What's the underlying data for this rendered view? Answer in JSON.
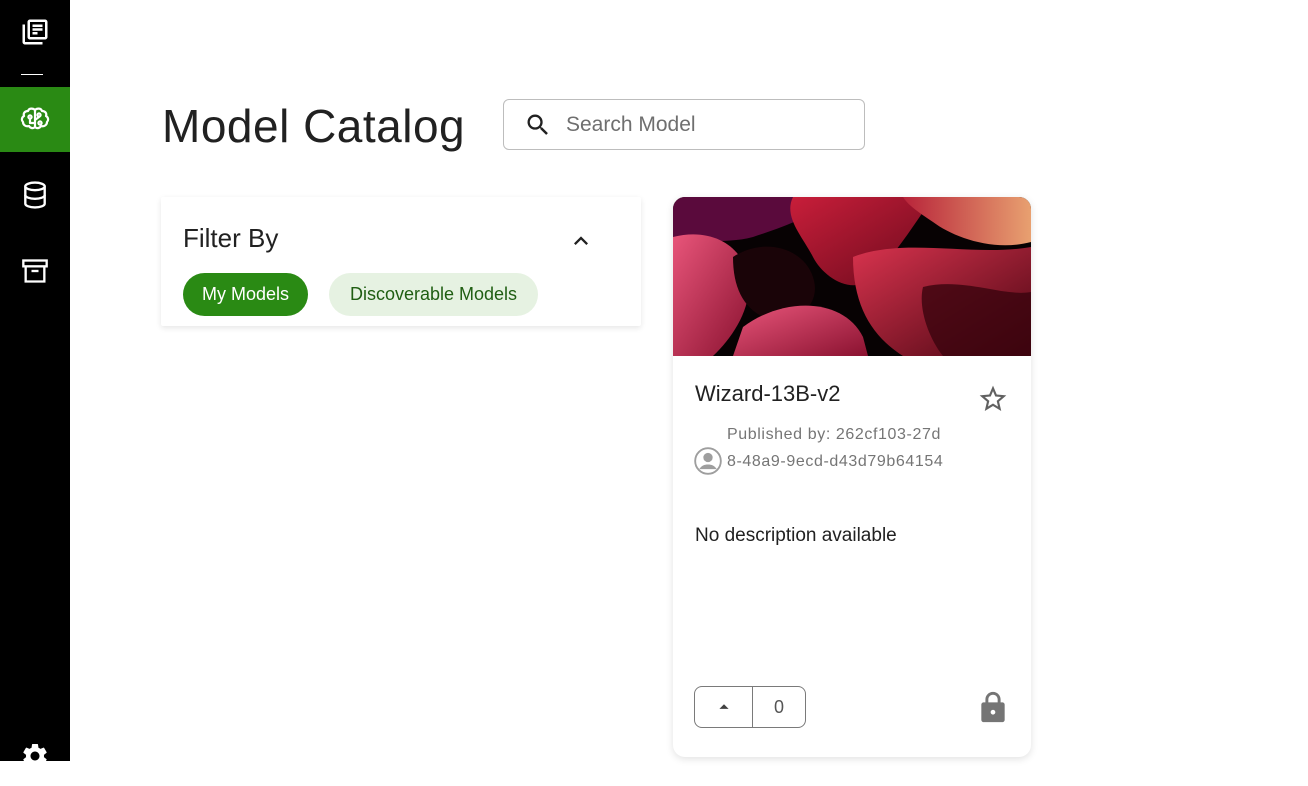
{
  "sidebar": {
    "items": [
      {
        "name": "library-icon",
        "active": false
      },
      {
        "name": "brain-icon",
        "active": true
      },
      {
        "name": "database-icon",
        "active": false
      },
      {
        "name": "archive-icon",
        "active": false
      },
      {
        "name": "gear-icon",
        "active": false
      }
    ],
    "active_color": "#2a8a14"
  },
  "header": {
    "title": "Model Catalog",
    "search_placeholder": "Search Model",
    "search_value": ""
  },
  "filter": {
    "title": "Filter By",
    "chips": [
      {
        "label": "My Models",
        "selected": true
      },
      {
        "label": "Discoverable Models",
        "selected": false
      }
    ]
  },
  "cards": [
    {
      "title": "Wizard-13B-v2",
      "published_by": "Published by: 262cf103-27d8-48a9-9ecd-d43d79b64154",
      "description": "No description available",
      "upvotes": "0",
      "starred": false,
      "locked": true
    }
  ],
  "colors": {
    "brand_green": "#2a8a14",
    "chip_light": "#e6f2e2",
    "sidebar_bg": "#000000"
  }
}
